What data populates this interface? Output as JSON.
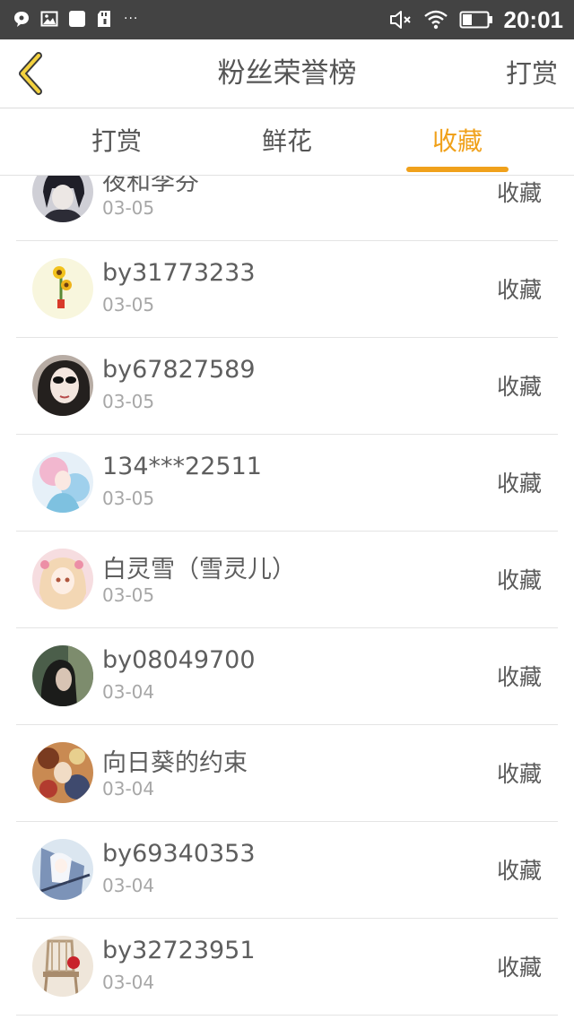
{
  "status_bar": {
    "time": "20:01",
    "dots": "···",
    "icons": [
      "chat-bubble-icon",
      "image-icon",
      "app-square-icon",
      "sd-card-icon",
      "mute-icon",
      "wifi-icon",
      "battery-icon"
    ]
  },
  "nav": {
    "title": "粉丝荣誉榜",
    "right_label": "打赏",
    "back_icon": "chevron-left-icon",
    "accent": "#f0a11b"
  },
  "tabs": [
    {
      "label": "打赏",
      "active": false
    },
    {
      "label": "鲜花",
      "active": false
    },
    {
      "label": "收藏",
      "active": true
    }
  ],
  "rows": [
    {
      "name": "夜和李芬",
      "date": "03-05",
      "action": "收藏"
    },
    {
      "name": "by31773233",
      "date": "03-05",
      "action": "收藏"
    },
    {
      "name": "by67827589",
      "date": "03-05",
      "action": "收藏"
    },
    {
      "name": "134***22511",
      "date": "03-05",
      "action": "收藏"
    },
    {
      "name": "白灵雪（雪灵儿）",
      "date": "03-05",
      "action": "收藏"
    },
    {
      "name": "by08049700",
      "date": "03-04",
      "action": "收藏"
    },
    {
      "name": "向日葵的约束",
      "date": "03-04",
      "action": "收藏"
    },
    {
      "name": "by69340353",
      "date": "03-04",
      "action": "收藏"
    },
    {
      "name": "by32723951",
      "date": "03-04",
      "action": "收藏"
    }
  ]
}
